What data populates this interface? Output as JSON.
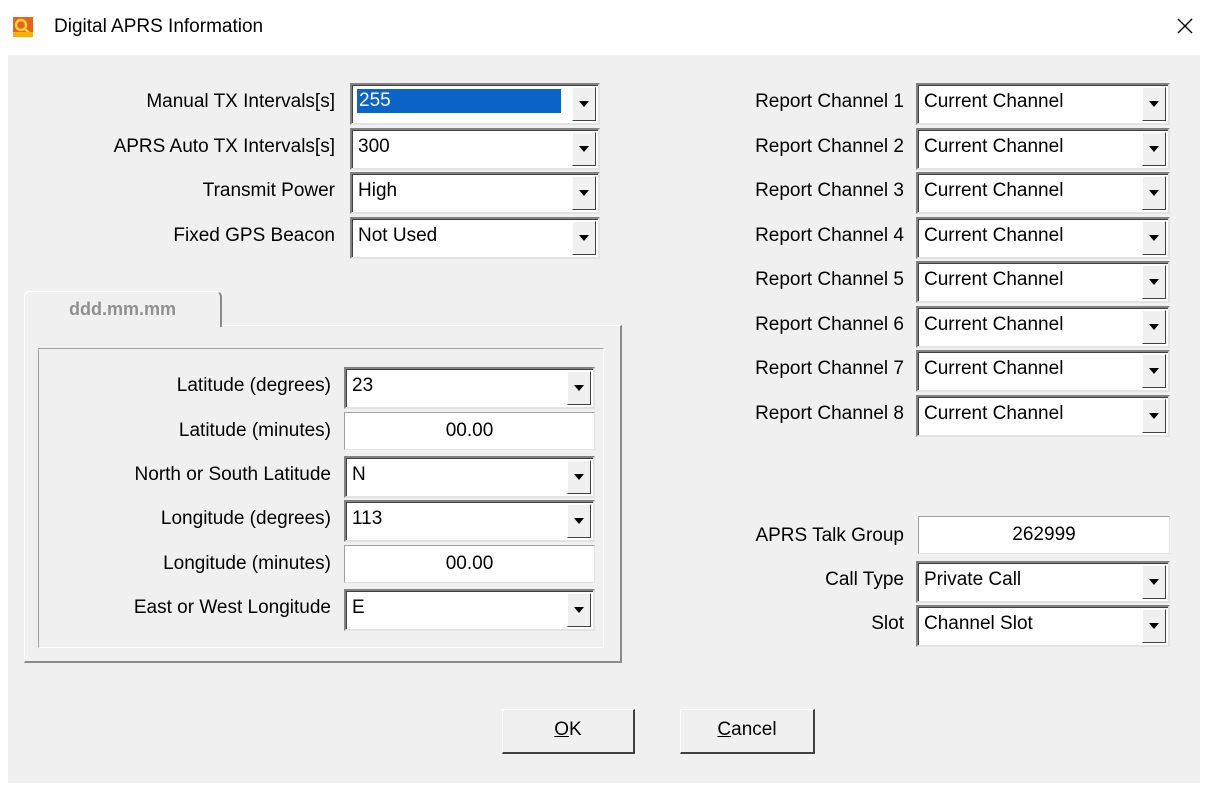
{
  "window": {
    "title": "Digital APRS Information",
    "close_symbol": "✕",
    "icon": "app-logo-icon"
  },
  "left_fields": {
    "manual_tx": {
      "label": "Manual TX Intervals[s]",
      "value": "255"
    },
    "auto_tx": {
      "label": "APRS Auto TX Intervals[s]",
      "value": "300"
    },
    "power": {
      "label": "Transmit Power",
      "value": "High"
    },
    "fixed_gps": {
      "label": "Fixed GPS Beacon",
      "value": "Not Used"
    }
  },
  "coords": {
    "tab_label": "ddd.mm.mm",
    "lat_deg": {
      "label": "Latitude (degrees)",
      "value": "23"
    },
    "lat_min": {
      "label": "Latitude (minutes)",
      "value": "00.00"
    },
    "ns": {
      "label": "North or South Latitude",
      "value": "N"
    },
    "lon_deg": {
      "label": "Longitude (degrees)",
      "value": "113"
    },
    "lon_min": {
      "label": "Longitude (minutes)",
      "value": "00.00"
    },
    "ew": {
      "label": "East or West Longitude",
      "value": "E"
    }
  },
  "report_channels": [
    {
      "label": "Report Channel 1",
      "value": "Current Channel"
    },
    {
      "label": "Report Channel 2",
      "value": "Current Channel"
    },
    {
      "label": "Report Channel 3",
      "value": "Current Channel"
    },
    {
      "label": "Report Channel 4",
      "value": "Current Channel"
    },
    {
      "label": "Report Channel 5",
      "value": "Current Channel"
    },
    {
      "label": "Report Channel 6",
      "value": "Current Channel"
    },
    {
      "label": "Report Channel 7",
      "value": "Current Channel"
    },
    {
      "label": "Report Channel 8",
      "value": "Current Channel"
    }
  ],
  "talk": {
    "group": {
      "label": "APRS Talk Group",
      "value": "262999"
    },
    "call_type": {
      "label": "Call Type",
      "value": "Private Call"
    },
    "slot": {
      "label": "Slot",
      "value": "Channel Slot"
    }
  },
  "buttons": {
    "ok": {
      "mnemonic": "O",
      "rest": "K"
    },
    "cancel": {
      "mnemonic": "C",
      "rest": "ancel"
    }
  },
  "colors": {
    "background": "#f0f0f0",
    "selection": "#0a64c8"
  }
}
